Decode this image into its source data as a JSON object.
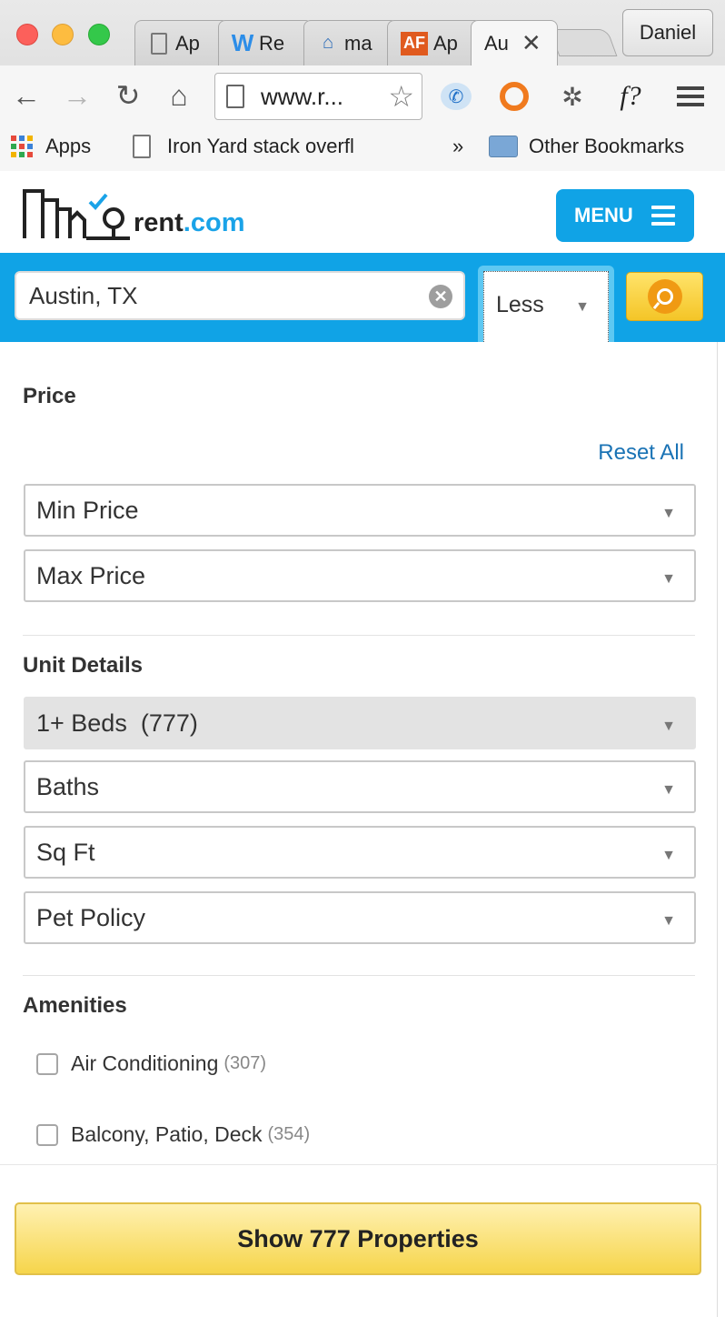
{
  "browser": {
    "tabs": [
      {
        "label": "Ap",
        "icon": "page-icon"
      },
      {
        "label": "Re",
        "icon": "weebly-icon"
      },
      {
        "label": "ma",
        "icon": "house-icon"
      },
      {
        "label": "Ap",
        "icon": "af-icon",
        "icon_text": "AF"
      },
      {
        "label": "Au",
        "icon": "none",
        "active": true
      }
    ],
    "profile_name": "Daniel",
    "url": "www.r...",
    "bookmarks": {
      "apps": "Apps",
      "item1": "Iron Yard stack overfl",
      "overflow": "»",
      "other": "Other Bookmarks"
    }
  },
  "site": {
    "logo_rent": "rent",
    "logo_com": ".com",
    "menu_label": "MENU",
    "search_value": "Austin, TX",
    "less_label": "Less",
    "accent_color": "#10a3e6"
  },
  "filters": {
    "price": {
      "title": "Price",
      "reset_label": "Reset All",
      "min_price": "Min Price",
      "max_price": "Max Price"
    },
    "unit_details": {
      "title": "Unit Details",
      "beds": "1+ Beds  (777)",
      "baths": "Baths",
      "sqft": "Sq Ft",
      "pet_policy": "Pet Policy"
    },
    "amenities": {
      "title": "Amenities",
      "items": [
        {
          "label": "Air Conditioning",
          "count": "(307)",
          "checked": false
        },
        {
          "label": "Balcony, Patio, Deck",
          "count": "(354)",
          "checked": false
        }
      ]
    },
    "show_button": "Show 777 Properties"
  }
}
